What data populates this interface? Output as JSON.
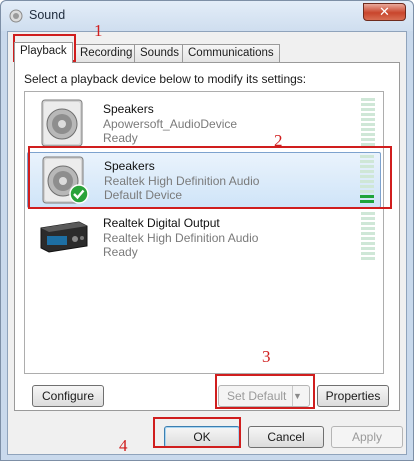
{
  "window": {
    "title": "Sound",
    "close_glyph": "✕"
  },
  "tabs": [
    {
      "label": "Playback",
      "active": true
    },
    {
      "label": "Recording",
      "active": false
    },
    {
      "label": "Sounds",
      "active": false
    },
    {
      "label": "Communications",
      "active": false
    }
  ],
  "instruction": "Select a playback device below to modify its settings:",
  "devices": [
    {
      "name": "Speakers",
      "line2": "Apowersoft_AudioDevice",
      "line3": "Ready",
      "icon": "speaker-icon",
      "selected": false,
      "meter_level": 0
    },
    {
      "name": "Speakers",
      "line2": "Realtek High Definition Audio",
      "line3": "Default Device",
      "icon": "speaker-default-icon",
      "selected": true,
      "meter_level": 0.2
    },
    {
      "name": "Realtek Digital Output",
      "line2": "Realtek High Definition Audio",
      "line3": "Ready",
      "icon": "digital-output-icon",
      "selected": false,
      "meter_level": 0
    }
  ],
  "buttons": {
    "configure": "Configure",
    "set_default": "Set Default",
    "set_default_arrow": "▼",
    "properties": "Properties",
    "ok": "OK",
    "cancel": "Cancel",
    "apply": "Apply"
  },
  "annotations": [
    "1",
    "2",
    "3",
    "4"
  ],
  "colors": {
    "annotation": "#d01e1e",
    "meter_on": "#1fa33a",
    "selection": "#cfe4f8"
  }
}
